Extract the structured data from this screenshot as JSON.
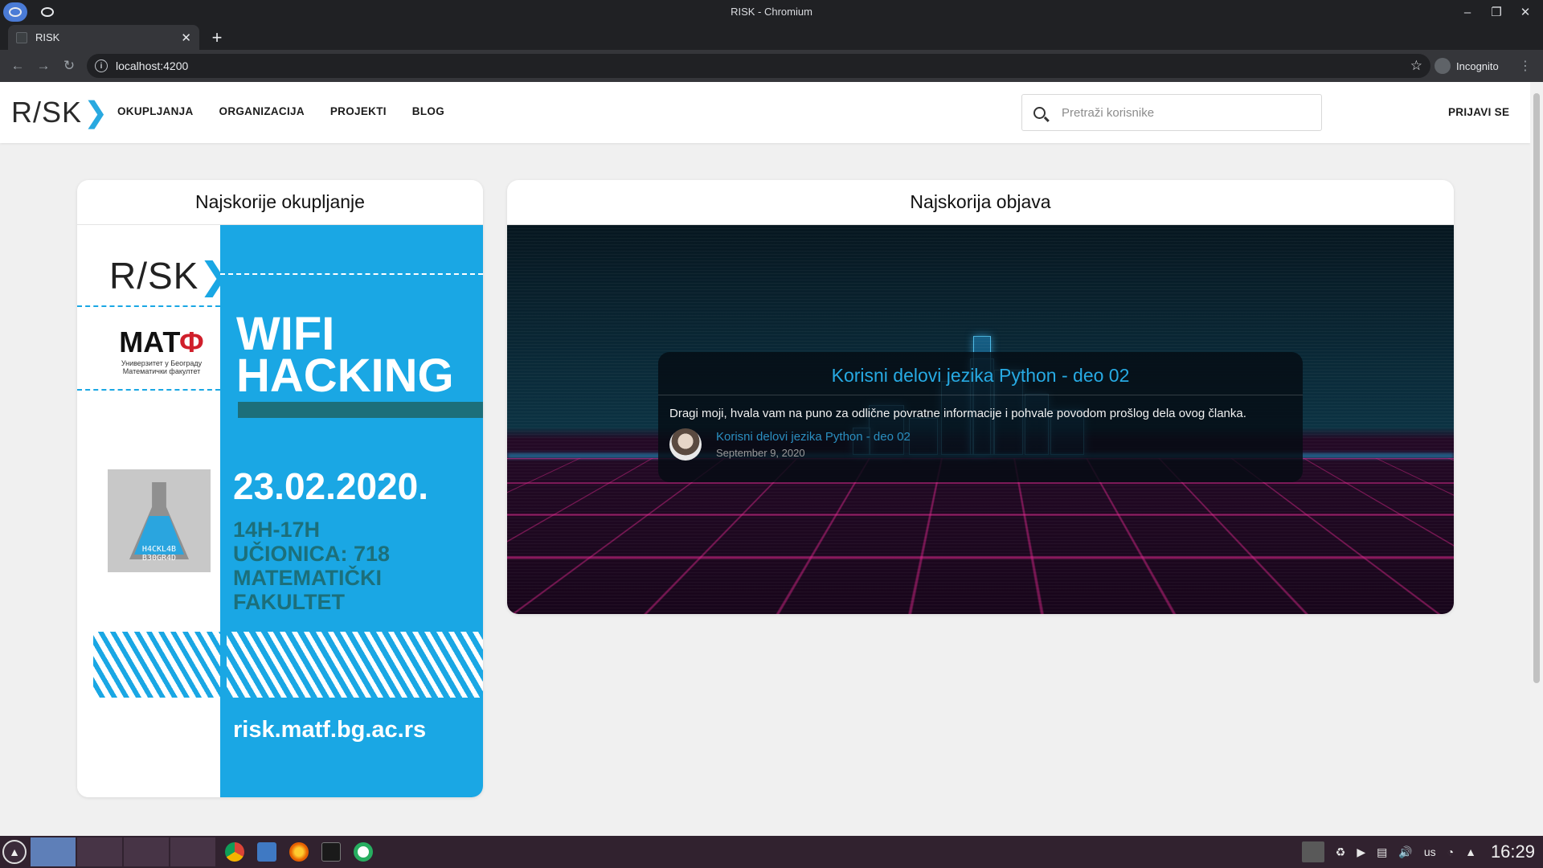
{
  "window": {
    "title": "RISK - Chromium"
  },
  "tab": {
    "label": "RISK",
    "close": "✕",
    "new": "+"
  },
  "toolbar": {
    "url": "localhost:4200",
    "incognito_label": "Incognito"
  },
  "header": {
    "logo": "R/SK",
    "nav": [
      "OKUPLJANJA",
      "ORGANIZACIJA",
      "PROJEKTI",
      "BLOG"
    ],
    "search_placeholder": "Pretraži korisnike",
    "login_label": "PRIJAVI SE"
  },
  "event_card": {
    "title": "Najskorije okupljanje",
    "poster": {
      "logo": "R/SK",
      "matf_big": "МАТ",
      "matf_red": "Ф",
      "matf_small_1": "Универзитет у Београду",
      "matf_small_2": "Математички факултет",
      "hacklab_1": "H4CKL4B",
      "hacklab_2": "B30GR4D",
      "headline_1": "WIFI",
      "headline_2": "HACKING",
      "date": "23.02.2020.",
      "detail_1": "14H-17H",
      "detail_2": "UČIONICA: 718",
      "detail_3": "MATEMATIČKI",
      "detail_4": "FAKULTET",
      "url": "risk.matf.bg.ac.rs"
    }
  },
  "post_card": {
    "title": "Najskorija objava",
    "post_title": "Korisni delovi jezika Python - deo 02",
    "excerpt": "Dragi moji, hvala vam na puno za odlične povratne informacije i pohvale povodom prošlog dela ovog članka.",
    "meta_link": "Korisni delovi jezika Python - deo 02",
    "date": "September 9, 2020"
  },
  "taskbar": {
    "keyboard_layout": "us",
    "clock": "16:29"
  },
  "colors": {
    "accent": "#29a9e0",
    "poster_blue": "#1aa7e4",
    "poster_teal": "#1c6f7a",
    "matf_red": "#d01f2b"
  }
}
